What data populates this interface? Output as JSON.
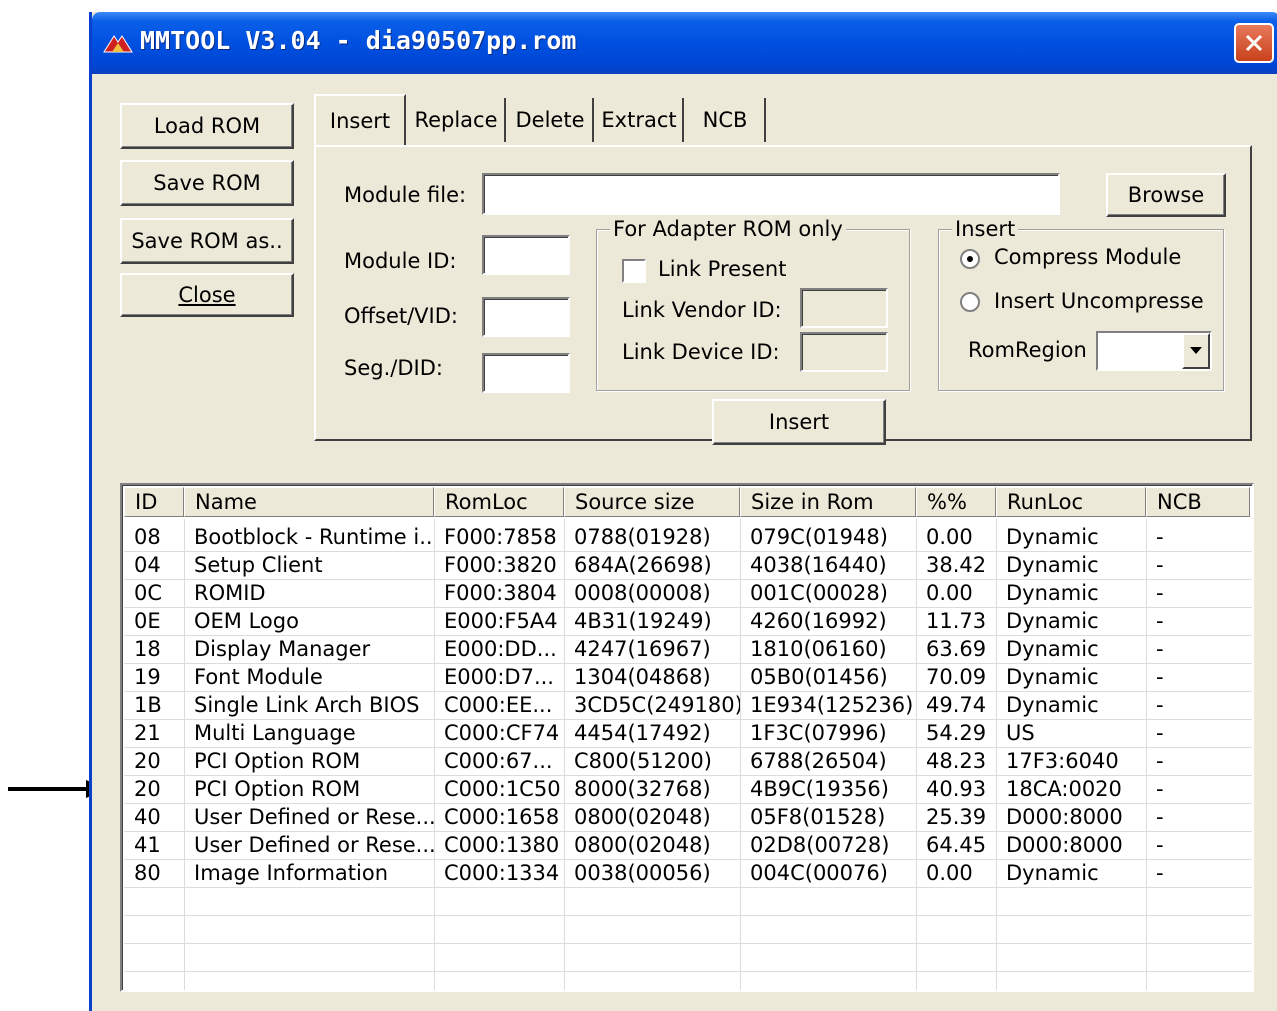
{
  "window": {
    "title": "MMTOOL V3.04 - dia90507pp.rom",
    "app_icon": "mmtool-logo-icon",
    "close_icon": "close-icon"
  },
  "left_buttons": {
    "load_rom": "Load ROM",
    "save_rom": "Save ROM",
    "save_rom_as": "Save ROM as..",
    "close": "Close"
  },
  "tabs": [
    {
      "label": "Insert",
      "active": true
    },
    {
      "label": "Replace",
      "active": false
    },
    {
      "label": "Delete",
      "active": false
    },
    {
      "label": "Extract",
      "active": false
    },
    {
      "label": "NCB",
      "active": false
    }
  ],
  "insert_panel": {
    "module_file_label": "Module file:",
    "module_file_value": "",
    "browse_label": "Browse",
    "module_id_label": "Module ID:",
    "module_id_value": "",
    "offset_vid_label": "Offset/VID:",
    "offset_vid_value": "",
    "seg_did_label": "Seg./DID:",
    "seg_did_value": "",
    "adapter_group": {
      "title": "For Adapter ROM only",
      "link_present_label": "Link Present",
      "link_present_checked": false,
      "link_vendor_id_label": "Link Vendor ID:",
      "link_device_id_label": "Link Device ID:"
    },
    "insert_group": {
      "title": "Insert",
      "compress_module_label": "Compress Module",
      "insert_uncompressed_label": "Insert Uncompresse",
      "selected": "Compress Module",
      "romregion_label": "RomRegion",
      "romregion_value": ""
    },
    "insert_button_label": "Insert"
  },
  "module_list": {
    "columns": [
      "ID",
      "Name",
      "RomLoc",
      "Source size",
      "Size in Rom",
      "%%",
      "RunLoc",
      "NCB"
    ],
    "rows": [
      [
        "08",
        "Bootblock - Runtime i...",
        "F000:7858",
        "0788(01928)",
        "079C(01948)",
        "0.00",
        "Dynamic",
        "-"
      ],
      [
        "04",
        "Setup Client",
        "F000:3820",
        "684A(26698)",
        "4038(16440)",
        "38.42",
        "Dynamic",
        "-"
      ],
      [
        "0C",
        "ROMID",
        "F000:3804",
        "0008(00008)",
        "001C(00028)",
        "0.00",
        "Dynamic",
        "-"
      ],
      [
        "0E",
        "OEM Logo",
        "E000:F5A4",
        "4B31(19249)",
        "4260(16992)",
        "11.73",
        "Dynamic",
        "-"
      ],
      [
        "18",
        "Display Manager",
        "E000:DD...",
        "4247(16967)",
        "1810(06160)",
        "63.69",
        "Dynamic",
        "-"
      ],
      [
        "19",
        "Font Module",
        "E000:D7...",
        "1304(04868)",
        "05B0(01456)",
        "70.09",
        "Dynamic",
        "-"
      ],
      [
        "1B",
        "Single Link Arch BIOS",
        "C000:EE...",
        "3CD5C(249180)",
        "1E934(125236)",
        "49.74",
        "Dynamic",
        "-"
      ],
      [
        "21",
        "Multi Language",
        "C000:CF74",
        "4454(17492)",
        "1F3C(07996)",
        "54.29",
        "US",
        "-"
      ],
      [
        "20",
        "PCI Option ROM",
        "C000:67...",
        "C800(51200)",
        "6788(26504)",
        "48.23",
        "17F3:6040",
        "-"
      ],
      [
        "20",
        "PCI Option ROM",
        "C000:1C50",
        "8000(32768)",
        "4B9C(19356)",
        "40.93",
        "18CA:0020",
        "-"
      ],
      [
        "40",
        "User Defined or Rese...",
        "C000:1658",
        "0800(02048)",
        "05F8(01528)",
        "25.39",
        "D000:8000",
        "-"
      ],
      [
        "41",
        "User Defined or Rese...",
        "C000:1380",
        "0800(02048)",
        "02D8(00728)",
        "64.45",
        "D000:8000",
        "-"
      ],
      [
        "80",
        "Image Information",
        "C000:1334",
        "0038(00056)",
        "004C(00076)",
        "0.00",
        "Dynamic",
        "-"
      ]
    ]
  },
  "annotation": {
    "arrow_icon": "right-arrow-icon",
    "points_to_row": 10
  },
  "colors": {
    "titlebar": "#0050e0",
    "window_bg": "#ece9d8",
    "close_button": "#d8532b"
  }
}
